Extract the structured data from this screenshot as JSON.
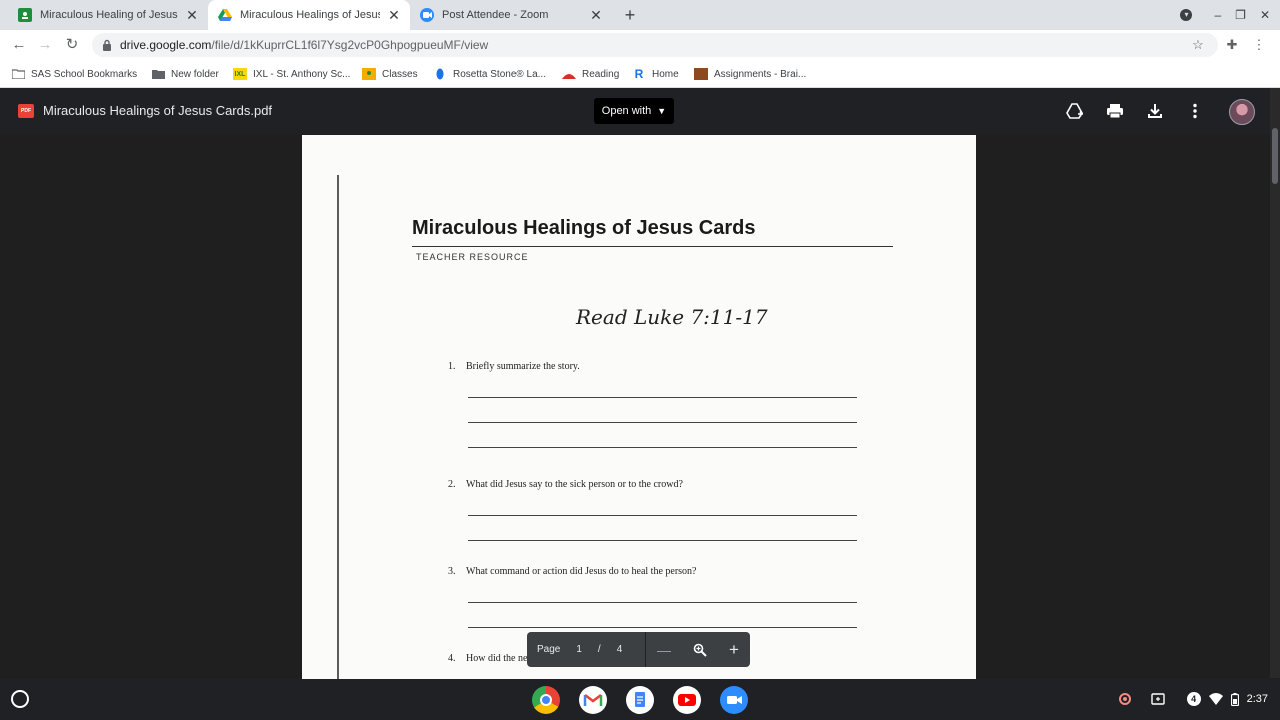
{
  "browser": {
    "tabs": [
      {
        "title": "Miraculous Healing of Jesus Ca",
        "favicon": "google-classroom-icon",
        "active": false
      },
      {
        "title": "Miraculous Healings of Jesus C",
        "favicon": "google-drive-icon",
        "active": true
      },
      {
        "title": "Post Attendee - Zoom",
        "favicon": "zoom-icon",
        "active": false
      }
    ],
    "url_host": "drive.google.com",
    "url_path": "/file/d/1kKuprrCL1f6l7Ysg2vcP0GhpogpueuMF/view",
    "bookmarks": [
      {
        "label": "SAS School Bookmarks",
        "icon": "folder-icon"
      },
      {
        "label": "New folder",
        "icon": "folder-icon"
      },
      {
        "label": "IXL - St. Anthony Sc...",
        "icon": "ixl-icon"
      },
      {
        "label": "Classes",
        "icon": "classroom-icon"
      },
      {
        "label": "Rosetta Stone® La...",
        "icon": "rosetta-icon"
      },
      {
        "label": "Reading",
        "icon": "reading-icon"
      },
      {
        "label": "Home",
        "icon": "r-icon"
      },
      {
        "label": "Assignments - Brai...",
        "icon": "braincheck-icon"
      }
    ]
  },
  "viewer": {
    "file_name": "Miraculous Healings of Jesus Cards.pdf",
    "open_with": "Open with",
    "pdf_badge": "PDF"
  },
  "document": {
    "title": "Miraculous Healings of Jesus Cards",
    "subtitle": "TEACHER RESOURCE",
    "reading": "Read Luke 7:11-17",
    "questions": [
      {
        "num": "1.",
        "text": "Briefly summarize the story."
      },
      {
        "num": "2.",
        "text": "What did Jesus say to the sick person or to the crowd?"
      },
      {
        "num": "3.",
        "text": "What command or action did Jesus do to heal the person?"
      },
      {
        "num": "4.",
        "text": "How did the newly healed person or the crowd respond to the healing?"
      }
    ]
  },
  "pagebar": {
    "label": "Page",
    "current": "1",
    "sep": "/",
    "total": "4"
  },
  "shelf": {
    "apps": [
      "chrome-icon",
      "gmail-icon",
      "docs-icon",
      "youtube-icon",
      "zoom-icon"
    ],
    "notification_count": "4",
    "time": "2:37"
  },
  "colors": {
    "accent": "#1a73e8",
    "viewer_bg": "#1f1f1f",
    "pdf_red": "#ea4335"
  }
}
